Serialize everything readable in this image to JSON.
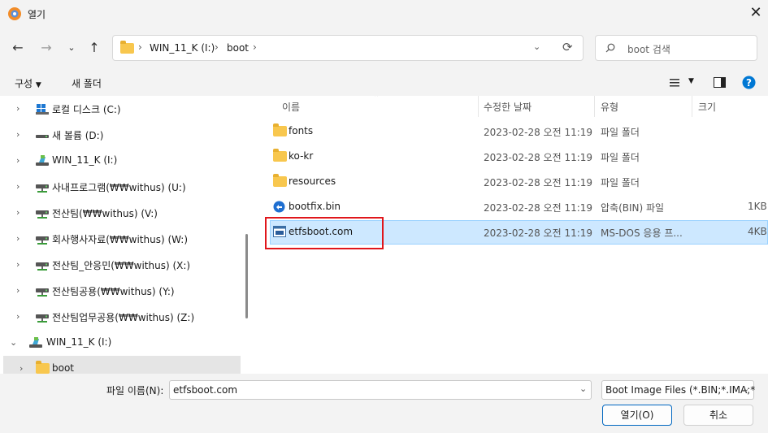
{
  "window": {
    "title": "열기"
  },
  "nav": {
    "breadcrumb": [
      "WIN_11_K (I:)",
      "boot"
    ],
    "search_placeholder": "boot 검색"
  },
  "toolbar": {
    "organize": "구성",
    "new_folder": "새 폴더"
  },
  "tree": [
    {
      "label": "로컬 디스크 (C:)",
      "icon": "local-disk-icon",
      "depth": 1
    },
    {
      "label": "새 볼륨 (D:)",
      "icon": "drive-icon",
      "depth": 1
    },
    {
      "label": "WIN_11_K (I:)",
      "icon": "usb-drive-icon",
      "depth": 1
    },
    {
      "label": "사내프로그램(₩₩withus) (U:)",
      "icon": "network-drive-icon",
      "depth": 1
    },
    {
      "label": "전산팀(₩₩withus) (V:)",
      "icon": "network-drive-icon",
      "depth": 1
    },
    {
      "label": "회사행사자료(₩₩withus) (W:)",
      "icon": "network-drive-icon",
      "depth": 1
    },
    {
      "label": "전산팀_안응민(₩₩withus) (X:)",
      "icon": "network-drive-icon",
      "depth": 1
    },
    {
      "label": "전산팀공용(₩₩withus) (Y:)",
      "icon": "network-drive-icon",
      "depth": 1
    },
    {
      "label": "전산팀업무공용(₩₩withus) (Z:)",
      "icon": "network-drive-icon",
      "depth": 1
    },
    {
      "label": "WIN_11_K (I:)",
      "icon": "usb-drive-icon",
      "depth": 0
    },
    {
      "label": "boot",
      "icon": "folder-icon",
      "depth": 1
    }
  ],
  "columns": {
    "name": "이름",
    "date": "수정한 날짜",
    "type": "유형",
    "size": "크기"
  },
  "files": [
    {
      "name": "fonts",
      "date": "2023-02-28 오전 11:19",
      "type": "파일 폴더",
      "size": "",
      "icon": "folder-icon"
    },
    {
      "name": "ko-kr",
      "date": "2023-02-28 오전 11:19",
      "type": "파일 폴더",
      "size": "",
      "icon": "folder-icon"
    },
    {
      "name": "resources",
      "date": "2023-02-28 오전 11:19",
      "type": "파일 폴더",
      "size": "",
      "icon": "folder-icon"
    },
    {
      "name": "bootfix.bin",
      "date": "2023-02-28 오전 11:19",
      "type": "압축(BIN) 파일",
      "size": "1KB",
      "icon": "bin-file-icon"
    },
    {
      "name": "etfsboot.com",
      "date": "2023-02-28 오전 11:19",
      "type": "MS-DOS 응용 프...",
      "size": "4KB",
      "icon": "msdos-app-icon"
    }
  ],
  "bottom": {
    "filename_label": "파일 이름(N):",
    "filename_value": "etfsboot.com",
    "filter": "Boot Image Files (*.BIN;*.IMA;*",
    "open": "열기(O)",
    "cancel": "취소"
  },
  "colors": {
    "selection": "#cde8ff",
    "highlight_box": "#e0161b",
    "accent": "#0067c0"
  }
}
